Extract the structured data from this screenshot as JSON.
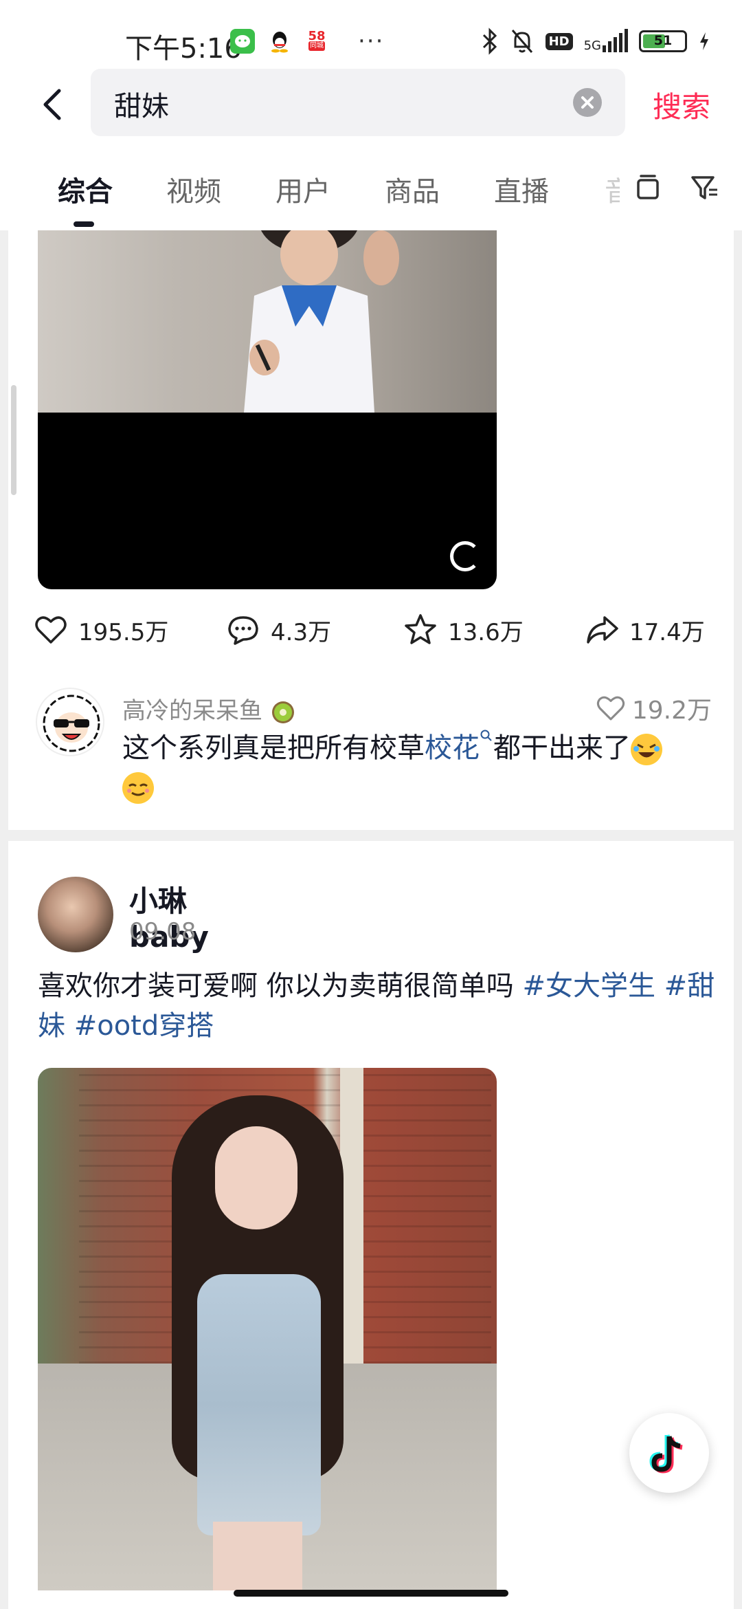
{
  "status_bar": {
    "time": "下午5:16",
    "app_icon_labels": [
      "58",
      "同城"
    ],
    "more_dots": "···",
    "hd_badge": "HD",
    "network": "5G",
    "battery_level": "51"
  },
  "search": {
    "query": "甜妹",
    "action_label": "搜索"
  },
  "tabs": {
    "items": [
      {
        "label": "综合",
        "active": true
      },
      {
        "label": "视频",
        "active": false
      },
      {
        "label": "用户",
        "active": false
      },
      {
        "label": "商品",
        "active": false
      },
      {
        "label": "直播",
        "active": false
      },
      {
        "label": "音",
        "active": false
      }
    ]
  },
  "card1": {
    "actions": {
      "likes": "195.5万",
      "comments": "4.3万",
      "favorites": "13.6万",
      "shares": "17.4万"
    },
    "comment": {
      "author": "高冷的呆呆鱼",
      "likes": "19.2万",
      "text_before": "这个系列真是把所有校草",
      "link": "校花",
      "text_after": "都干出来了"
    }
  },
  "card2": {
    "author": "小琳baby",
    "date": "09.08",
    "caption": "喜欢你才装可爱啊 你以为卖萌很简单吗 ",
    "tags": [
      "#女大学生",
      "#甜妹",
      "#ootd穿搭"
    ]
  },
  "colors": {
    "accent": "#fe2c55",
    "link": "#2b5897",
    "text": "#161823",
    "muted": "#8a8a8a"
  },
  "icons": [
    "back-icon",
    "clear-icon",
    "layout-icon",
    "filter-icon",
    "heart-icon",
    "comment-icon",
    "star-icon",
    "share-icon",
    "loading-icon",
    "more-icon",
    "tiktok-icon"
  ]
}
